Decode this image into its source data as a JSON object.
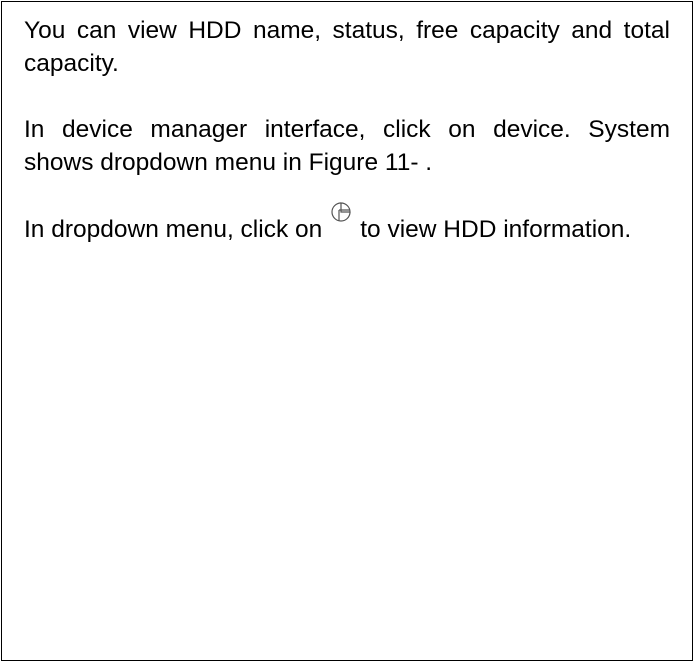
{
  "paragraphs": {
    "p1": "You can view HDD name, status, free capacity and total capacity.",
    "p2": "In device manager interface, click on device. System shows dropdown menu in Figure 11- .",
    "p3_before": "In dropdown menu, click on",
    "p3_after": "to view HDD information."
  },
  "icons": {
    "hdd_info": "hdd-pie-chart-icon"
  }
}
